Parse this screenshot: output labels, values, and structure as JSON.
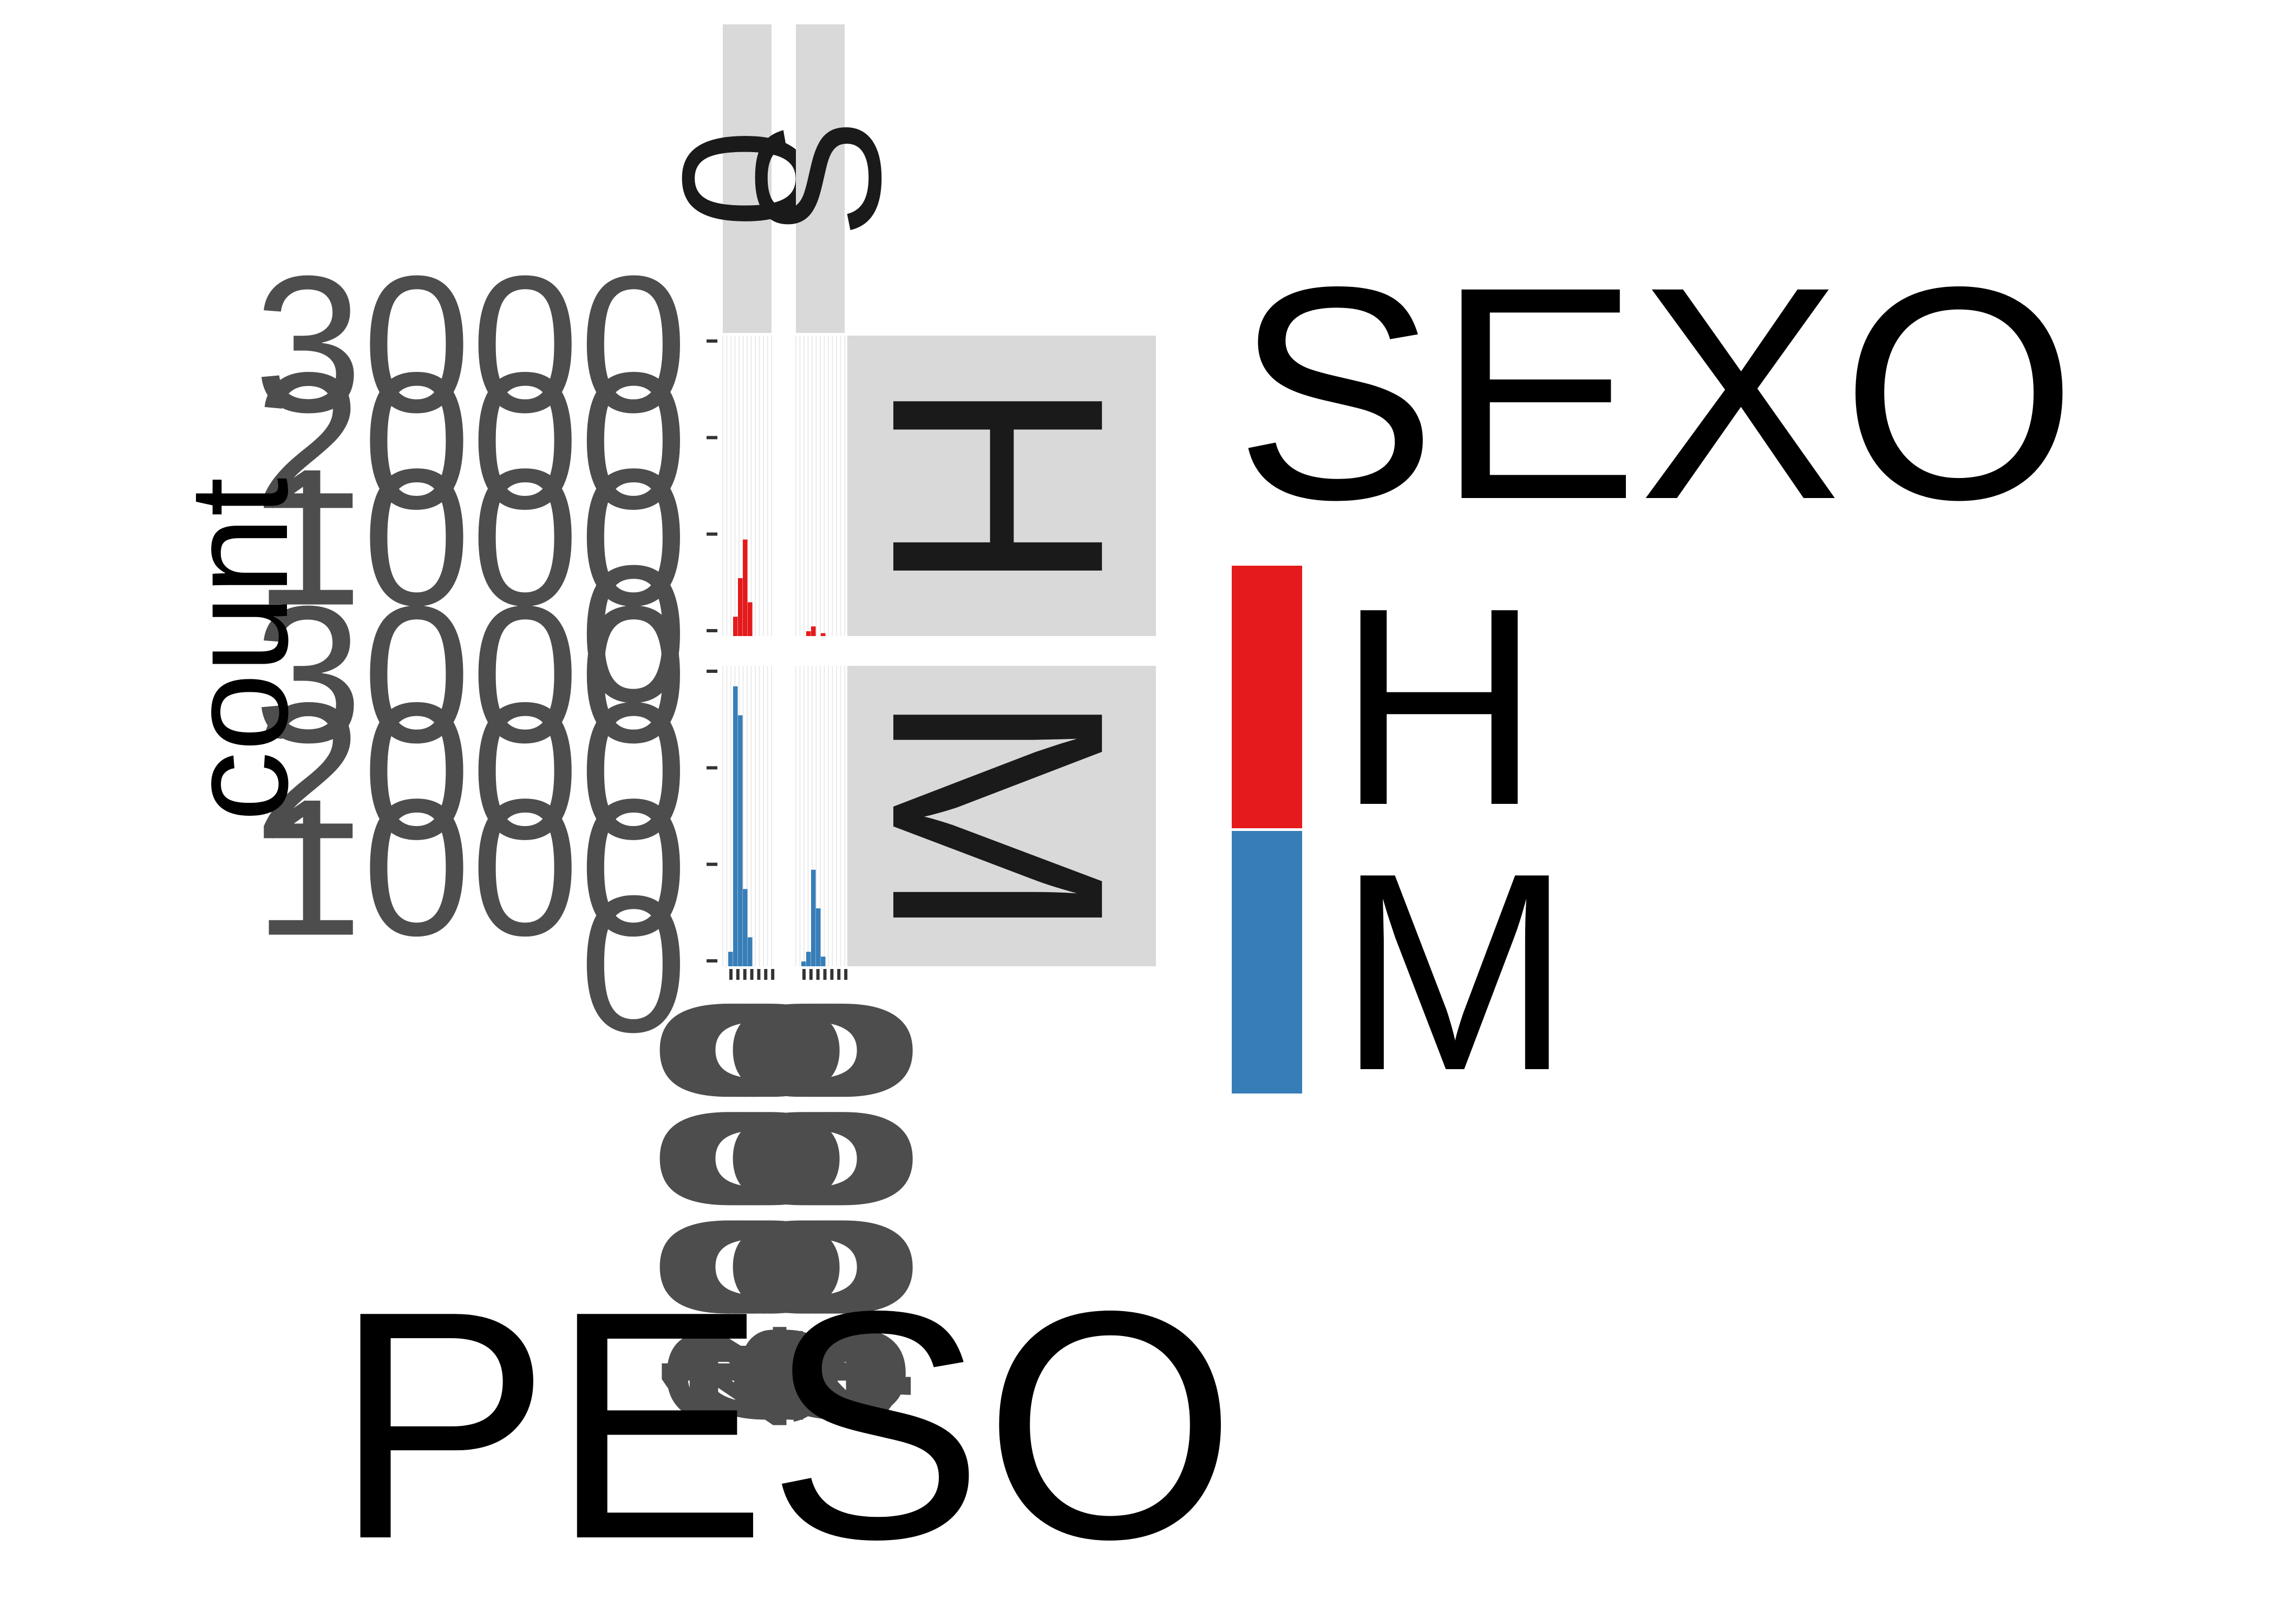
{
  "chart_data": {
    "type": "bar",
    "subtype": "faceted-histogram",
    "xlabel": "PESO",
    "ylabel": "count",
    "legend": {
      "title": "SEXO",
      "position": "right",
      "entries": [
        {
          "label": "H",
          "color": "#E41A1C"
        },
        {
          "label": "M",
          "color": "#377EB8"
        }
      ]
    },
    "facet_cols": [
      "0",
      "S"
    ],
    "facet_rows": [
      "H",
      "M"
    ],
    "y_tick_labels": [
      "0",
      "1000",
      "2000",
      "3000"
    ],
    "x_tick_labels": [
      "1000",
      "2000",
      "3000",
      "4000",
      "5000",
      "6000",
      "7000"
    ],
    "ylim": [
      0,
      3000
    ],
    "panels": [
      {
        "col": "0",
        "row": "H",
        "color": "#E41A1C",
        "values": [
          0,
          200,
          600,
          1000,
          350,
          0,
          0
        ]
      },
      {
        "col": "S",
        "row": "H",
        "color": "#E41A1C",
        "values": [
          0,
          50,
          100,
          0,
          30,
          0,
          0
        ]
      },
      {
        "col": "0",
        "row": "M",
        "color": "#377EB8",
        "values": [
          150,
          2900,
          2600,
          800,
          300,
          0,
          0
        ]
      },
      {
        "col": "S",
        "row": "M",
        "color": "#377EB8",
        "values": [
          50,
          150,
          1000,
          600,
          100,
          0,
          0
        ]
      }
    ]
  }
}
